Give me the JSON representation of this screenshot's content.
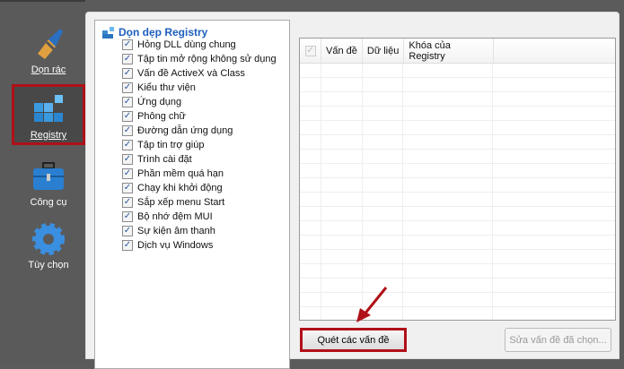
{
  "sidebar": {
    "items": [
      {
        "label": "Dọn rác",
        "icon": "broom-icon"
      },
      {
        "label": "Registry",
        "icon": "registry-cubes-icon",
        "selected": true
      },
      {
        "label": "Công cụ",
        "icon": "toolbox-icon"
      },
      {
        "label": "Tùy chọn",
        "icon": "gear-icon"
      }
    ]
  },
  "registry": {
    "title": "Dọn dẹp Registry",
    "items": [
      "Hỏng DLL dùng chung",
      "Tập tin mở rộng không sử dụng",
      "Vấn đề ActiveX và Class",
      "Kiểu thư viện",
      "Ứng dụng",
      "Phông chữ",
      "Đường dẫn ứng dụng",
      "Tập tin trợ giúp",
      "Trình cài đặt",
      "Phần mềm quá hạn",
      "Chạy khi khởi động",
      "Sắp xếp menu Start",
      "Bộ nhớ đệm MUI",
      "Sự kiện âm thanh",
      "Dịch vụ Windows"
    ]
  },
  "table": {
    "columns": [
      "Vấn đề",
      "Dữ liệu",
      "Khóa của Registry"
    ]
  },
  "buttons": {
    "scan": "Quét các vấn đề",
    "fix": "Sửa vấn đề đã chọn..."
  },
  "colors": {
    "highlight": "#b01018",
    "title": "#1f5fbf"
  }
}
